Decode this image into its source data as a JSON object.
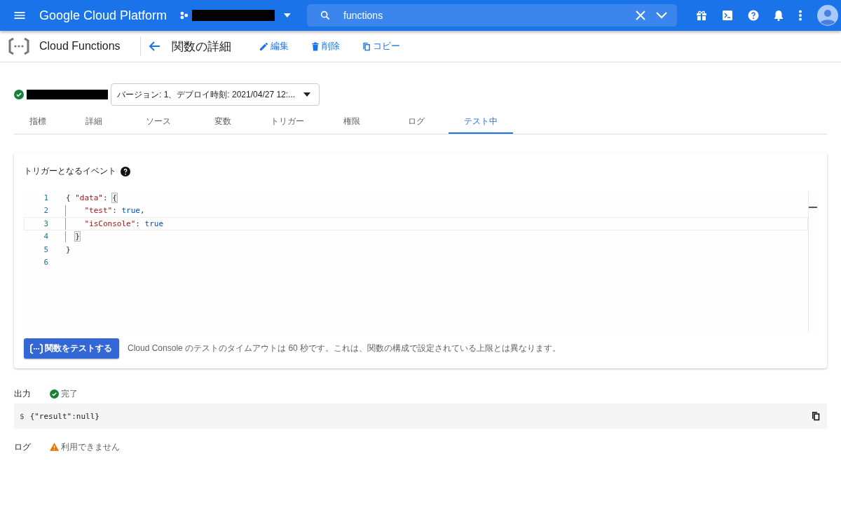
{
  "top_bar": {
    "brand": "Google Cloud Platform",
    "search": {
      "value": "functions"
    }
  },
  "sub_header": {
    "product": "Cloud Functions",
    "page_title": "関数の詳細",
    "actions": [
      {
        "kind": "edit",
        "label": "編集"
      },
      {
        "kind": "delete",
        "label": "削除"
      },
      {
        "kind": "copy",
        "label": "コピー"
      }
    ]
  },
  "function": {
    "deployed": true,
    "version_select": "バージョン: 1、デプロイ時刻: 2021/04/27 12:..."
  },
  "tabs": [
    {
      "label": "指標",
      "selected": false
    },
    {
      "label": "詳細",
      "selected": false
    },
    {
      "label": "ソース",
      "selected": false
    },
    {
      "label": "変数",
      "selected": false
    },
    {
      "label": "トリガー",
      "selected": false
    },
    {
      "label": "権限",
      "selected": false
    },
    {
      "label": "ログ",
      "selected": false
    },
    {
      "label": "テスト中",
      "selected": true
    }
  ],
  "test_card": {
    "heading": "トリガーとなるイベント",
    "editor": {
      "lines": [
        {
          "number": "1",
          "current": false,
          "indent_guide": false,
          "tokens": [
            {
              "kind": "punct",
              "text": "{ "
            },
            {
              "kind": "key",
              "text": "\"data\""
            },
            {
              "kind": "punct",
              "text": ": "
            },
            {
              "kind": "match",
              "text": "{"
            }
          ]
        },
        {
          "number": "2",
          "current": false,
          "indent_guide": true,
          "tokens": [
            {
              "kind": "indent"
            },
            {
              "kind": "key",
              "text": "\"test\""
            },
            {
              "kind": "punct",
              "text": ": "
            },
            {
              "kind": "literal",
              "text": "true"
            },
            {
              "kind": "punct",
              "text": ","
            }
          ]
        },
        {
          "number": "3",
          "current": true,
          "indent_guide": true,
          "tokens": [
            {
              "kind": "indent"
            },
            {
              "kind": "key",
              "text": "\"isConsole\""
            },
            {
              "kind": "punct",
              "text": ": "
            },
            {
              "kind": "literal",
              "text": "true"
            }
          ]
        },
        {
          "number": "4",
          "current": false,
          "indent_guide": true,
          "tokens": [
            {
              "kind": "half_indent"
            },
            {
              "kind": "match",
              "text": "}"
            }
          ]
        },
        {
          "number": "5",
          "current": false,
          "indent_guide": false,
          "tokens": [
            {
              "kind": "punct",
              "text": "}"
            }
          ]
        },
        {
          "number": "6",
          "current": false,
          "indent_guide": false
        }
      ]
    },
    "test_button": "関数をテストする",
    "note": "Cloud Console のテストのタイムアウトは 60 秒です。これは、関数の構成で設定されている上限とは異なります。"
  },
  "output": {
    "label": "出力",
    "succeeded": true,
    "status_text": "完了",
    "prompt": "$",
    "result": "{\"result\":null}"
  },
  "log": {
    "label": "ログ",
    "available": false,
    "status_text": "利用できません"
  }
}
